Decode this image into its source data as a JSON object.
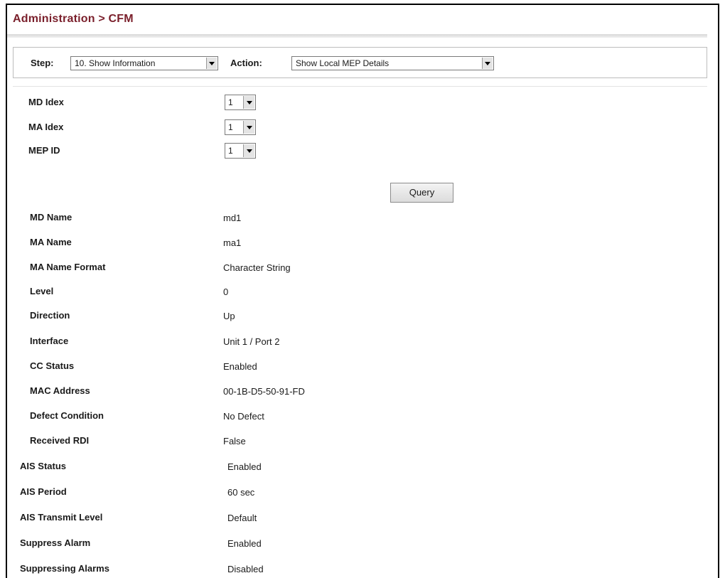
{
  "header": {
    "title": "Administration > CFM"
  },
  "toolbar": {
    "step_label": "Step:",
    "step_value": "10. Show Information",
    "action_label": "Action:",
    "action_value": "Show Local MEP Details"
  },
  "selectors": [
    {
      "label": "MD Idex",
      "value": "1"
    },
    {
      "label": "MA Idex",
      "value": "1"
    },
    {
      "label": "MEP ID",
      "value": "1"
    }
  ],
  "query_label": "Query",
  "details": [
    {
      "label": "MD Name",
      "value": "md1"
    },
    {
      "label": "MA Name",
      "value": "ma1"
    },
    {
      "label": "MA Name Format",
      "value": "Character String"
    },
    {
      "label": "Level",
      "value": "0"
    },
    {
      "label": "Direction",
      "value": "Up"
    },
    {
      "label": "Interface",
      "value": "Unit 1 / Port 2"
    },
    {
      "label": "CC Status",
      "value": "Enabled"
    },
    {
      "label": "MAC Address",
      "value": "00-1B-D5-50-91-FD"
    },
    {
      "label": "Defect Condition",
      "value": "No Defect"
    },
    {
      "label": "Received RDI",
      "value": "False"
    },
    {
      "label": "AIS Status",
      "value": "Enabled"
    },
    {
      "label": "AIS Period",
      "value": "60 sec"
    },
    {
      "label": "AIS Transmit Level",
      "value": "Default"
    },
    {
      "label": "Suppress Alarm",
      "value": "Enabled"
    },
    {
      "label": "Suppressing Alarms",
      "value": "Disabled"
    }
  ]
}
